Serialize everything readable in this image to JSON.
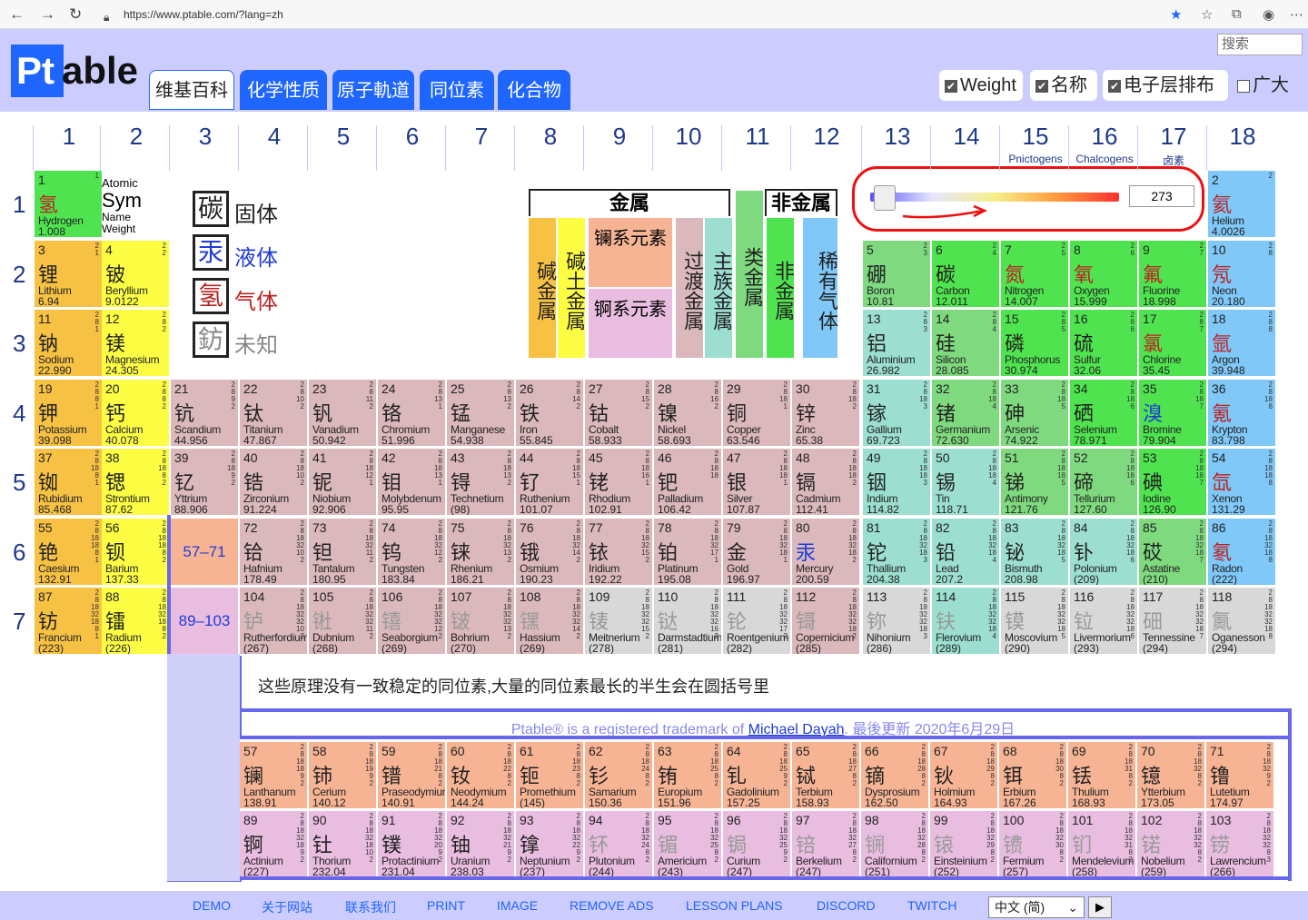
{
  "browser": {
    "url": "https://www.ptable.com/?lang=zh"
  },
  "header": {
    "logo": "Ptable",
    "logo_p": "Pt",
    "logo_rest": "able",
    "search_placeholder": "搜索",
    "tabs": [
      "维基百科",
      "化学性质",
      "原子軌道",
      "同位素",
      "化合物"
    ],
    "checks": [
      {
        "label": "Weight",
        "on": true
      },
      {
        "label": "名称",
        "on": true
      },
      {
        "label": "电子层排布",
        "on": true
      },
      {
        "label": "广大",
        "on": false
      }
    ]
  },
  "groups": [
    "1",
    "2",
    "3",
    "4",
    "5",
    "6",
    "7",
    "8",
    "9",
    "10",
    "11",
    "12",
    "13",
    "14",
    "15",
    "16",
    "17",
    "18"
  ],
  "group_subs": {
    "15": "Pnictogens",
    "16": "Chalcogens",
    "17": "卤素"
  },
  "periods": [
    "1",
    "2",
    "3",
    "4",
    "5",
    "6",
    "7"
  ],
  "key": {
    "n": "Atomic",
    "s": "Sym",
    "en": "Name",
    "w": "Weight"
  },
  "states": [
    {
      "z": "碳",
      "label": "固体"
    },
    {
      "z": "汞",
      "label": "液体"
    },
    {
      "z": "氢",
      "label": "气体"
    },
    {
      "z": "鈁",
      "label": "未知"
    }
  ],
  "categories": {
    "metal": "金属",
    "nonmetal": "非金属",
    "alk": "碱金属",
    "ae": "碱土金属",
    "lan": "镧系元素",
    "act": "锕系元素",
    "tm": "过渡金属",
    "pt": "主族金属",
    "met": "类金属",
    "nm": "非金属",
    "ng": "稀有气体"
  },
  "temperature": "273",
  "placeholders": {
    "lan": "57–71",
    "act": "89–103"
  },
  "note": "这些原理没有一致稳定的同位素,大量的同位素最长的半生会在圆括号里",
  "trademark": {
    "prefix": "Ptable® is a registered trademark of ",
    "name": "Michael Dayah",
    "suffix": ". 最後更新 2020年6月29日"
  },
  "footer": {
    "links": [
      "DEMO",
      "关于网站",
      "联系我们",
      "PRINT",
      "IMAGE",
      "REMOVE ADS",
      "LESSON PLANS",
      "DISCORD",
      "TWITCH"
    ],
    "lang": "中文 (简)"
  },
  "colors": {
    "accent": "#1f66ff",
    "page_bg": "#ccccff",
    "highlight": "#e11111"
  },
  "elements": [
    [
      "1",
      "氢",
      "Hydrogen",
      "1.008",
      1,
      1,
      "nm",
      "gas",
      "1"
    ],
    [
      "2",
      "氦",
      "Helium",
      "4.0026",
      18,
      1,
      "ng",
      "gas",
      "2"
    ],
    [
      "3",
      "锂",
      "Lithium",
      "6.94",
      1,
      2,
      "alk",
      "solid",
      "2 1"
    ],
    [
      "4",
      "铍",
      "Beryllium",
      "9.0122",
      2,
      2,
      "ae",
      "solid",
      "2 2"
    ],
    [
      "5",
      "硼",
      "Boron",
      "10.81",
      13,
      2,
      "met",
      "solid",
      "2 3"
    ],
    [
      "6",
      "碳",
      "Carbon",
      "12.011",
      14,
      2,
      "nm",
      "solid",
      "2 4"
    ],
    [
      "7",
      "氮",
      "Nitrogen",
      "14.007",
      15,
      2,
      "nm",
      "gas",
      "2 5"
    ],
    [
      "8",
      "氧",
      "Oxygen",
      "15.999",
      16,
      2,
      "nm",
      "gas",
      "2 6"
    ],
    [
      "9",
      "氟",
      "Fluorine",
      "18.998",
      17,
      2,
      "nm",
      "gas",
      "2 7"
    ],
    [
      "10",
      "氖",
      "Neon",
      "20.180",
      18,
      2,
      "ng",
      "gas",
      "2 8"
    ],
    [
      "11",
      "钠",
      "Sodium",
      "22.990",
      1,
      3,
      "alk",
      "solid",
      "2 8 1"
    ],
    [
      "12",
      "镁",
      "Magnesium",
      "24.305",
      2,
      3,
      "ae",
      "solid",
      "2 8 2"
    ],
    [
      "13",
      "铝",
      "Aluminium",
      "26.982",
      13,
      3,
      "pt",
      "solid",
      "2 8 3"
    ],
    [
      "14",
      "硅",
      "Silicon",
      "28.085",
      14,
      3,
      "met",
      "solid",
      "2 8 4"
    ],
    [
      "15",
      "磷",
      "Phosphorus",
      "30.974",
      15,
      3,
      "nm",
      "solid",
      "2 8 5"
    ],
    [
      "16",
      "硫",
      "Sulfur",
      "32.06",
      16,
      3,
      "nm",
      "solid",
      "2 8 6"
    ],
    [
      "17",
      "氯",
      "Chlorine",
      "35.45",
      17,
      3,
      "nm",
      "gas",
      "2 8 7"
    ],
    [
      "18",
      "氩",
      "Argon",
      "39.948",
      18,
      3,
      "ng",
      "gas",
      "2 8 8"
    ],
    [
      "19",
      "钾",
      "Potassium",
      "39.098",
      1,
      4,
      "alk",
      "solid",
      "2 8 8 1"
    ],
    [
      "20",
      "钙",
      "Calcium",
      "40.078",
      2,
      4,
      "ae",
      "solid",
      "2 8 8 2"
    ],
    [
      "21",
      "钪",
      "Scandium",
      "44.956",
      3,
      4,
      "tm",
      "solid",
      "2 8 9 2"
    ],
    [
      "22",
      "钛",
      "Titanium",
      "47.867",
      4,
      4,
      "tm",
      "solid",
      "2 8 10 2"
    ],
    [
      "23",
      "钒",
      "Vanadium",
      "50.942",
      5,
      4,
      "tm",
      "solid",
      "2 8 11 2"
    ],
    [
      "24",
      "铬",
      "Chromium",
      "51.996",
      6,
      4,
      "tm",
      "solid",
      "2 8 13 1"
    ],
    [
      "25",
      "锰",
      "Manganese",
      "54.938",
      7,
      4,
      "tm",
      "solid",
      "2 8 13 2"
    ],
    [
      "26",
      "铁",
      "Iron",
      "55.845",
      8,
      4,
      "tm",
      "solid",
      "2 8 14 2"
    ],
    [
      "27",
      "钴",
      "Cobalt",
      "58.933",
      9,
      4,
      "tm",
      "solid",
      "2 8 15 2"
    ],
    [
      "28",
      "镍",
      "Nickel",
      "58.693",
      10,
      4,
      "tm",
      "solid",
      "2 8 16 2"
    ],
    [
      "29",
      "铜",
      "Copper",
      "63.546",
      11,
      4,
      "tm",
      "solid",
      "2 8 18 1"
    ],
    [
      "30",
      "锌",
      "Zinc",
      "65.38",
      12,
      4,
      "tm",
      "solid",
      "2 8 18 2"
    ],
    [
      "31",
      "镓",
      "Gallium",
      "69.723",
      13,
      4,
      "pt",
      "solid",
      "2 8 18 3"
    ],
    [
      "32",
      "锗",
      "Germanium",
      "72.630",
      14,
      4,
      "met",
      "solid",
      "2 8 18 4"
    ],
    [
      "33",
      "砷",
      "Arsenic",
      "74.922",
      15,
      4,
      "met",
      "solid",
      "2 8 18 5"
    ],
    [
      "34",
      "硒",
      "Selenium",
      "78.971",
      16,
      4,
      "nm",
      "solid",
      "2 8 18 6"
    ],
    [
      "35",
      "溴",
      "Bromine",
      "79.904",
      17,
      4,
      "nm",
      "liq",
      "2 8 18 7"
    ],
    [
      "36",
      "氪",
      "Krypton",
      "83.798",
      18,
      4,
      "ng",
      "gas",
      "2 8 18 8"
    ],
    [
      "37",
      "铷",
      "Rubidium",
      "85.468",
      1,
      5,
      "alk",
      "solid",
      "2 8 18 8 1"
    ],
    [
      "38",
      "锶",
      "Strontium",
      "87.62",
      2,
      5,
      "ae",
      "solid",
      "2 8 18 8 2"
    ],
    [
      "39",
      "钇",
      "Yttrium",
      "88.906",
      3,
      5,
      "tm",
      "solid",
      "2 8 18 9 2"
    ],
    [
      "40",
      "锆",
      "Zirconium",
      "91.224",
      4,
      5,
      "tm",
      "solid",
      "2 8 18 10 2"
    ],
    [
      "41",
      "铌",
      "Niobium",
      "92.906",
      5,
      5,
      "tm",
      "solid",
      "2 8 18 12 1"
    ],
    [
      "42",
      "钼",
      "Molybdenum",
      "95.95",
      6,
      5,
      "tm",
      "solid",
      "2 8 18 13 1"
    ],
    [
      "43",
      "锝",
      "Technetium",
      "(98)",
      7,
      5,
      "tm",
      "solid",
      "2 8 18 13 2"
    ],
    [
      "44",
      "钌",
      "Ruthenium",
      "101.07",
      8,
      5,
      "tm",
      "solid",
      "2 8 18 15 1"
    ],
    [
      "45",
      "铑",
      "Rhodium",
      "102.91",
      9,
      5,
      "tm",
      "solid",
      "2 8 18 16 1"
    ],
    [
      "46",
      "钯",
      "Palladium",
      "106.42",
      10,
      5,
      "tm",
      "solid",
      "2 8 18 18"
    ],
    [
      "47",
      "银",
      "Silver",
      "107.87",
      11,
      5,
      "tm",
      "solid",
      "2 8 18 18 1"
    ],
    [
      "48",
      "镉",
      "Cadmium",
      "112.41",
      12,
      5,
      "tm",
      "solid",
      "2 8 18 18 2"
    ],
    [
      "49",
      "铟",
      "Indium",
      "114.82",
      13,
      5,
      "pt",
      "solid",
      "2 8 18 18 3"
    ],
    [
      "50",
      "锡",
      "Tin",
      "118.71",
      14,
      5,
      "pt",
      "solid",
      "2 8 18 18 4"
    ],
    [
      "51",
      "锑",
      "Antimony",
      "121.76",
      15,
      5,
      "met",
      "solid",
      "2 8 18 18 5"
    ],
    [
      "52",
      "碲",
      "Tellurium",
      "127.60",
      16,
      5,
      "met",
      "solid",
      "2 8 18 18 6"
    ],
    [
      "53",
      "碘",
      "Iodine",
      "126.90",
      17,
      5,
      "nm",
      "solid",
      "2 8 18 18 7"
    ],
    [
      "54",
      "氙",
      "Xenon",
      "131.29",
      18,
      5,
      "ng",
      "gas",
      "2 8 18 18 8"
    ],
    [
      "55",
      "铯",
      "Caesium",
      "132.91",
      1,
      6,
      "alk",
      "solid",
      "2 8 18 18 8 1"
    ],
    [
      "56",
      "钡",
      "Barium",
      "137.33",
      2,
      6,
      "ae",
      "solid",
      "2 8 18 18 8 2"
    ],
    [
      "72",
      "铪",
      "Hafnium",
      "178.49",
      4,
      6,
      "tm",
      "solid",
      "2 8 18 32 10 2"
    ],
    [
      "73",
      "钽",
      "Tantalum",
      "180.95",
      5,
      6,
      "tm",
      "solid",
      "2 8 18 32 11 2"
    ],
    [
      "74",
      "钨",
      "Tungsten",
      "183.84",
      6,
      6,
      "tm",
      "solid",
      "2 8 18 32 12 2"
    ],
    [
      "75",
      "铼",
      "Rhenium",
      "186.21",
      7,
      6,
      "tm",
      "solid",
      "2 8 18 32 13 2"
    ],
    [
      "76",
      "锇",
      "Osmium",
      "190.23",
      8,
      6,
      "tm",
      "solid",
      "2 8 18 32 14 2"
    ],
    [
      "77",
      "铱",
      "Iridium",
      "192.22",
      9,
      6,
      "tm",
      "solid",
      "2 8 18 32 15 2"
    ],
    [
      "78",
      "铂",
      "Platinum",
      "195.08",
      10,
      6,
      "tm",
      "solid",
      "2 8 18 32 17 1"
    ],
    [
      "79",
      "金",
      "Gold",
      "196.97",
      11,
      6,
      "tm",
      "solid",
      "2 8 18 32 18 1"
    ],
    [
      "80",
      "汞",
      "Mercury",
      "200.59",
      12,
      6,
      "tm",
      "liq",
      "2 8 18 32 18 2"
    ],
    [
      "81",
      "铊",
      "Thallium",
      "204.38",
      13,
      6,
      "pt",
      "solid",
      "2 8 18 32 18 3"
    ],
    [
      "82",
      "铅",
      "Lead",
      "207.2",
      14,
      6,
      "pt",
      "solid",
      "2 8 18 32 18 4"
    ],
    [
      "83",
      "铋",
      "Bismuth",
      "208.98",
      15,
      6,
      "pt",
      "solid",
      "2 8 18 32 18 5"
    ],
    [
      "84",
      "钋",
      "Polonium",
      "(209)",
      16,
      6,
      "pt",
      "solid",
      "2 8 18 32 18 6"
    ],
    [
      "85",
      "砹",
      "Astatine",
      "(210)",
      17,
      6,
      "met",
      "solid",
      "2 8 18 32 18 7"
    ],
    [
      "86",
      "氡",
      "Radon",
      "(222)",
      18,
      6,
      "ng",
      "gas",
      "2 8 18 32 18 8"
    ],
    [
      "87",
      "钫",
      "Francium",
      "(223)",
      1,
      7,
      "alk",
      "solid",
      "2 8 18 32 18 8 1"
    ],
    [
      "88",
      "镭",
      "Radium",
      "(226)",
      2,
      7,
      "ae",
      "solid",
      "2 8 18 32 18 8 2"
    ],
    [
      "104",
      "𬬻",
      "Rutherfordium",
      "(267)",
      4,
      7,
      "tm",
      "unk",
      "2 8 18 32 32 10 2"
    ],
    [
      "105",
      "𬭊",
      "Dubnium",
      "(268)",
      5,
      7,
      "tm",
      "unk",
      "2 8 18 32 32 11 2"
    ],
    [
      "106",
      "𬭳",
      "Seaborgium",
      "(269)",
      6,
      7,
      "tm",
      "unk",
      "2 8 18 32 32 12 2"
    ],
    [
      "107",
      "𬭛",
      "Bohrium",
      "(270)",
      7,
      7,
      "tm",
      "unk",
      "2 8 18 32 32 13 2"
    ],
    [
      "108",
      "𬭶",
      "Hassium",
      "(269)",
      8,
      7,
      "tm",
      "unk",
      "2 8 18 32 32 14 2"
    ],
    [
      "109",
      "鿏",
      "Meitnerium",
      "(278)",
      9,
      7,
      "unk",
      "unk",
      "2 8 18 32 32 15 2"
    ],
    [
      "110",
      "𫟼",
      "Darmstadtium",
      "(281)",
      10,
      7,
      "unk",
      "unk",
      "2 8 18 32 32 16 2"
    ],
    [
      "111",
      "𬬭",
      "Roentgenium",
      "(282)",
      11,
      7,
      "unk",
      "unk",
      "2 8 18 32 32 17 2"
    ],
    [
      "112",
      "鿔",
      "Copernicium",
      "(285)",
      12,
      7,
      "tm",
      "unk",
      "2 8 18 32 32 18 2"
    ],
    [
      "113",
      "鿭",
      "Nihonium",
      "(286)",
      13,
      7,
      "unk",
      "unk",
      "2 8 18 32 32 18 3"
    ],
    [
      "114",
      "𫓧",
      "Flerovium",
      "(289)",
      14,
      7,
      "pt",
      "unk",
      "2 8 18 32 32 18 4"
    ],
    [
      "115",
      "镆",
      "Moscovium",
      "(290)",
      15,
      7,
      "unk",
      "unk",
      "2 8 18 32 32 18 5"
    ],
    [
      "116",
      "𫟷",
      "Livermorium",
      "(293)",
      16,
      7,
      "unk",
      "unk",
      "2 8 18 32 32 18 6"
    ],
    [
      "117",
      "鿬",
      "Tennessine",
      "(294)",
      17,
      7,
      "unk",
      "unk",
      "2 8 18 32 32 18 7"
    ],
    [
      "118",
      "鿫",
      "Oganesson",
      "(294)",
      18,
      7,
      "unk",
      "unk",
      "2 8 18 32 32 18 8"
    ]
  ],
  "lanthanides": [
    [
      "57",
      "镧",
      "Lanthanum",
      "138.91",
      "2 8 18 18 9 2"
    ],
    [
      "58",
      "铈",
      "Cerium",
      "140.12",
      "2 8 18 19 9 2"
    ],
    [
      "59",
      "镨",
      "Praseodymium",
      "140.91",
      "2 8 18 21 8 2"
    ],
    [
      "60",
      "钕",
      "Neodymium",
      "144.24",
      "2 8 18 22 8 2"
    ],
    [
      "61",
      "钷",
      "Promethium",
      "(145)",
      "2 8 18 23 8 2"
    ],
    [
      "62",
      "钐",
      "Samarium",
      "150.36",
      "2 8 18 24 8 2"
    ],
    [
      "63",
      "铕",
      "Europium",
      "151.96",
      "2 8 18 25 8 2"
    ],
    [
      "64",
      "钆",
      "Gadolinium",
      "157.25",
      "2 8 18 25 9 2"
    ],
    [
      "65",
      "铽",
      "Terbium",
      "158.93",
      "2 8 18 27 8 2"
    ],
    [
      "66",
      "镝",
      "Dysprosium",
      "162.50",
      "2 8 18 28 8 2"
    ],
    [
      "67",
      "钬",
      "Holmium",
      "164.93",
      "2 8 18 29 8 2"
    ],
    [
      "68",
      "铒",
      "Erbium",
      "167.26",
      "2 8 18 30 8 2"
    ],
    [
      "69",
      "铥",
      "Thulium",
      "168.93",
      "2 8 18 31 8 2"
    ],
    [
      "70",
      "镱",
      "Ytterbium",
      "173.05",
      "2 8 18 32 8 2"
    ],
    [
      "71",
      "镥",
      "Lutetium",
      "174.97",
      "2 8 18 32 9 2"
    ]
  ],
  "actinides": [
    [
      "89",
      "锕",
      "Actinium",
      "(227)",
      "2 8 18 32 18 9 2"
    ],
    [
      "90",
      "钍",
      "Thorium",
      "232.04",
      "2 8 18 32 18 10 2"
    ],
    [
      "91",
      "镤",
      "Protactinium",
      "231.04",
      "2 8 18 32 20 9 2"
    ],
    [
      "92",
      "铀",
      "Uranium",
      "238.03",
      "2 8 18 32 21 9 2"
    ],
    [
      "93",
      "镎",
      "Neptunium",
      "(237)",
      "2 8 18 32 22 9 2"
    ],
    [
      "94",
      "钚",
      "Plutonium",
      "(244)",
      "2 8 18 32 24 8 2"
    ],
    [
      "95",
      "镅",
      "Americium",
      "(243)",
      "2 8 18 32 25 8 2"
    ],
    [
      "96",
      "锔",
      "Curium",
      "(247)",
      "2 8 18 32 25 9 2"
    ],
    [
      "97",
      "锫",
      "Berkelium",
      "(247)",
      "2 8 18 32 27 8 2"
    ],
    [
      "98",
      "锎",
      "Californium",
      "(251)",
      "2 8 18 32 28 8 2"
    ],
    [
      "99",
      "锿",
      "Einsteinium",
      "(252)",
      "2 8 18 32 29 8 2"
    ],
    [
      "100",
      "镄",
      "Fermium",
      "(257)",
      "2 8 18 32 30 8 2"
    ],
    [
      "101",
      "钔",
      "Mendelevium",
      "(258)",
      "2 8 18 32 31 8 2"
    ],
    [
      "102",
      "锘",
      "Nobelium",
      "(259)",
      "2 8 18 32 32 8 2"
    ],
    [
      "103",
      "铹",
      "Lawrencium",
      "(266)",
      "2 8 18 32 32 8 3"
    ]
  ]
}
